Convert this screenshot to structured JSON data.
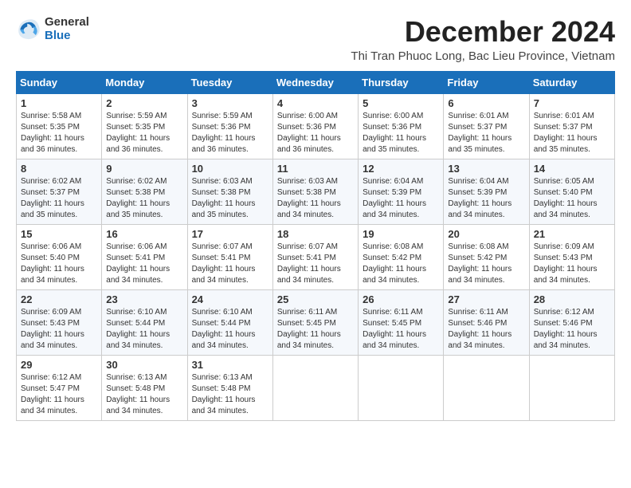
{
  "logo": {
    "general": "General",
    "blue": "Blue"
  },
  "title": "December 2024",
  "location": "Thi Tran Phuoc Long, Bac Lieu Province, Vietnam",
  "days_of_week": [
    "Sunday",
    "Monday",
    "Tuesday",
    "Wednesday",
    "Thursday",
    "Friday",
    "Saturday"
  ],
  "weeks": [
    [
      {
        "day": 1,
        "sunrise": "5:58 AM",
        "sunset": "5:35 PM",
        "daylight": "11 hours and 36 minutes."
      },
      {
        "day": 2,
        "sunrise": "5:59 AM",
        "sunset": "5:35 PM",
        "daylight": "11 hours and 36 minutes."
      },
      {
        "day": 3,
        "sunrise": "5:59 AM",
        "sunset": "5:36 PM",
        "daylight": "11 hours and 36 minutes."
      },
      {
        "day": 4,
        "sunrise": "6:00 AM",
        "sunset": "5:36 PM",
        "daylight": "11 hours and 36 minutes."
      },
      {
        "day": 5,
        "sunrise": "6:00 AM",
        "sunset": "5:36 PM",
        "daylight": "11 hours and 35 minutes."
      },
      {
        "day": 6,
        "sunrise": "6:01 AM",
        "sunset": "5:37 PM",
        "daylight": "11 hours and 35 minutes."
      },
      {
        "day": 7,
        "sunrise": "6:01 AM",
        "sunset": "5:37 PM",
        "daylight": "11 hours and 35 minutes."
      }
    ],
    [
      {
        "day": 8,
        "sunrise": "6:02 AM",
        "sunset": "5:37 PM",
        "daylight": "11 hours and 35 minutes."
      },
      {
        "day": 9,
        "sunrise": "6:02 AM",
        "sunset": "5:38 PM",
        "daylight": "11 hours and 35 minutes."
      },
      {
        "day": 10,
        "sunrise": "6:03 AM",
        "sunset": "5:38 PM",
        "daylight": "11 hours and 35 minutes."
      },
      {
        "day": 11,
        "sunrise": "6:03 AM",
        "sunset": "5:38 PM",
        "daylight": "11 hours and 34 minutes."
      },
      {
        "day": 12,
        "sunrise": "6:04 AM",
        "sunset": "5:39 PM",
        "daylight": "11 hours and 34 minutes."
      },
      {
        "day": 13,
        "sunrise": "6:04 AM",
        "sunset": "5:39 PM",
        "daylight": "11 hours and 34 minutes."
      },
      {
        "day": 14,
        "sunrise": "6:05 AM",
        "sunset": "5:40 PM",
        "daylight": "11 hours and 34 minutes."
      }
    ],
    [
      {
        "day": 15,
        "sunrise": "6:06 AM",
        "sunset": "5:40 PM",
        "daylight": "11 hours and 34 minutes."
      },
      {
        "day": 16,
        "sunrise": "6:06 AM",
        "sunset": "5:41 PM",
        "daylight": "11 hours and 34 minutes."
      },
      {
        "day": 17,
        "sunrise": "6:07 AM",
        "sunset": "5:41 PM",
        "daylight": "11 hours and 34 minutes."
      },
      {
        "day": 18,
        "sunrise": "6:07 AM",
        "sunset": "5:41 PM",
        "daylight": "11 hours and 34 minutes."
      },
      {
        "day": 19,
        "sunrise": "6:08 AM",
        "sunset": "5:42 PM",
        "daylight": "11 hours and 34 minutes."
      },
      {
        "day": 20,
        "sunrise": "6:08 AM",
        "sunset": "5:42 PM",
        "daylight": "11 hours and 34 minutes."
      },
      {
        "day": 21,
        "sunrise": "6:09 AM",
        "sunset": "5:43 PM",
        "daylight": "11 hours and 34 minutes."
      }
    ],
    [
      {
        "day": 22,
        "sunrise": "6:09 AM",
        "sunset": "5:43 PM",
        "daylight": "11 hours and 34 minutes."
      },
      {
        "day": 23,
        "sunrise": "6:10 AM",
        "sunset": "5:44 PM",
        "daylight": "11 hours and 34 minutes."
      },
      {
        "day": 24,
        "sunrise": "6:10 AM",
        "sunset": "5:44 PM",
        "daylight": "11 hours and 34 minutes."
      },
      {
        "day": 25,
        "sunrise": "6:11 AM",
        "sunset": "5:45 PM",
        "daylight": "11 hours and 34 minutes."
      },
      {
        "day": 26,
        "sunrise": "6:11 AM",
        "sunset": "5:45 PM",
        "daylight": "11 hours and 34 minutes."
      },
      {
        "day": 27,
        "sunrise": "6:11 AM",
        "sunset": "5:46 PM",
        "daylight": "11 hours and 34 minutes."
      },
      {
        "day": 28,
        "sunrise": "6:12 AM",
        "sunset": "5:46 PM",
        "daylight": "11 hours and 34 minutes."
      }
    ],
    [
      {
        "day": 29,
        "sunrise": "6:12 AM",
        "sunset": "5:47 PM",
        "daylight": "11 hours and 34 minutes."
      },
      {
        "day": 30,
        "sunrise": "6:13 AM",
        "sunset": "5:48 PM",
        "daylight": "11 hours and 34 minutes."
      },
      {
        "day": 31,
        "sunrise": "6:13 AM",
        "sunset": "5:48 PM",
        "daylight": "11 hours and 34 minutes."
      },
      null,
      null,
      null,
      null
    ]
  ]
}
